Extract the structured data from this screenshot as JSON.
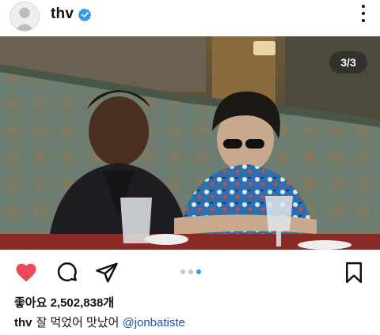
{
  "post": {
    "username": "thv",
    "verified": true,
    "carousel_counter": "3/3",
    "carousel": {
      "total": 3,
      "current": 3
    },
    "likes_text": "좋아요 2,502,838개",
    "caption_user": "thv",
    "caption_text": "잘 먹었어 맛났어",
    "caption_mention": "@jonbatiste"
  },
  "icons": {
    "like": "heart-filled-icon",
    "comment": "comment-bubble-icon",
    "share": "paper-plane-icon",
    "save": "bookmark-icon",
    "more": "more-vertical-icon",
    "verified": "verified-badge-icon"
  },
  "colors": {
    "like_red": "#ed4956",
    "verified_blue": "#3897f0",
    "mention_blue": "#1c4fa6",
    "active_dot": "#3897f0"
  }
}
